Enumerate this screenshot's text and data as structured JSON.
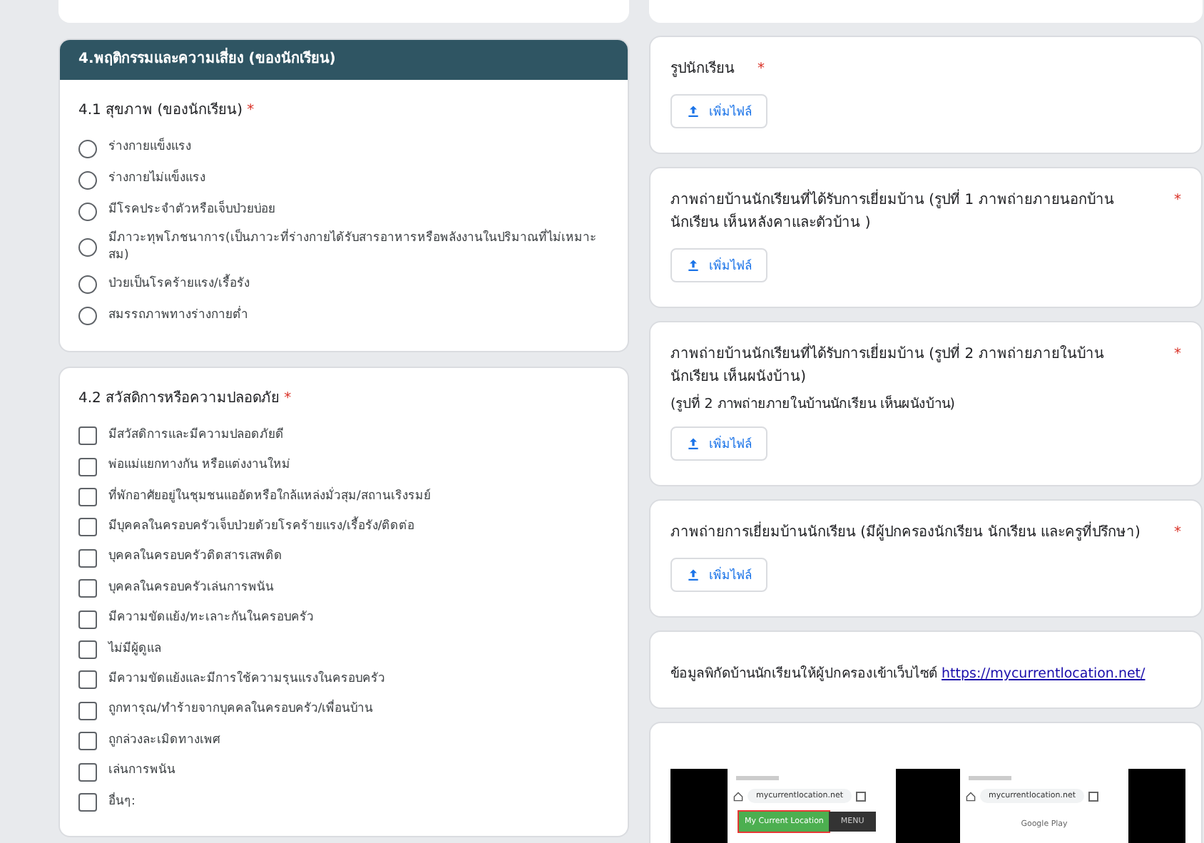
{
  "left_sections": [
    {
      "kind": "radio",
      "header": "4.พฤติกรรมและความเสี่ยง (ของนักเรียน)",
      "question": "4.1 สุขภาพ (ของนักเรียน)",
      "required_mark": "*",
      "options": [
        {
          "label": "ร่างกายแข็งแรง",
          "selected": false
        },
        {
          "label": "ร่างกายไม่แข็งแรง",
          "selected": false
        },
        {
          "label": "มีโรคประจำตัวหรือเจ็บป่วยบ่อย",
          "selected": false
        },
        {
          "label": "มีภาวะทุพโภชนาการ(เป็นภาวะที่ร่างกายได้รับสารอาหารหรือพลังงานในปริมาณที่ไม่เหมาะสม)",
          "selected": false
        },
        {
          "label": "ป่วยเป็นโรคร้ายแรง/เรื้อรัง",
          "selected": false
        },
        {
          "label": "สมรรถภาพทางร่างกายต่ำ",
          "selected": false
        }
      ]
    },
    {
      "kind": "checkbox",
      "question": "4.2  สวัสดิการหรือความปลอดภัย",
      "required_mark": "*",
      "options": [
        {
          "label": "มีสวัสดิการและมีความปลอดภัยดี",
          "checked": false
        },
        {
          "label": "พ่อแม่แยกทางกัน หรือแต่งงานใหม่",
          "checked": false
        },
        {
          "label": "ที่พักอาศัยอยู่ในชุมชนแออัดหรือใกล้แหล่งมั่วสุม/สถานเริงรมย์",
          "checked": false
        },
        {
          "label": "มีบุคคลในครอบครัวเจ็บป่วยด้วยโรคร้ายแรง/เรื้อรัง/ติดต่อ",
          "checked": false
        },
        {
          "label": "บุคคลในครอบครัวติดสารเสพติด",
          "checked": false
        },
        {
          "label": "บุคคลในครอบครัวเล่นการพนัน",
          "checked": false
        },
        {
          "label": "มีความขัดแย้ง/ทะเลาะกันในครอบครัว",
          "checked": false
        },
        {
          "label": "ไม่มีผู้ดูแล",
          "checked": false
        },
        {
          "label": "มีความขัดแย้งและมีการใช้ความรุนแรงในครอบครัว",
          "checked": false
        },
        {
          "label": "ถูกทารุณ/ทำร้ายจากบุคคลในครอบครัว/เพื่อนบ้าน",
          "checked": false
        },
        {
          "label": "ถูกล่วงละเมิดทางเพศ",
          "checked": false
        },
        {
          "label": "เล่นการพนัน",
          "checked": false
        },
        {
          "label": "อื่นๆ:",
          "checked": false
        }
      ]
    }
  ],
  "right_cards": [
    {
      "kind": "upload",
      "title": "รูปนักเรียน",
      "required_mark": "*",
      "button": "เพิ่มไฟล์"
    },
    {
      "kind": "upload",
      "title": "ภาพถ่ายบ้านนักเรียนที่ได้รับการเยี่ยมบ้าน (รูปที่ 1 ภาพถ่ายภายนอกบ้านนักเรียน เห็นหลังคาและตัวบ้าน )",
      "required_mark": "*",
      "button": "เพิ่มไฟล์"
    },
    {
      "kind": "upload",
      "title": "ภาพถ่ายบ้านนักเรียนที่ได้รับการเยี่ยมบ้าน (รูปที่ 2 ภาพถ่ายภายในบ้านนักเรียน เห็นผนังบ้าน)",
      "subtitle": " (รูปที่ 2 ภาพถ่ายภายในบ้านนักเรียน เห็นผนังบ้าน)",
      "required_mark": "*",
      "button": "เพิ่มไฟล์"
    },
    {
      "kind": "upload",
      "title": "ภาพถ่ายการเยี่ยมบ้านนักเรียน (มีผู้ปกครองนักเรียน นักเรียน และครูที่ปรึกษา)",
      "required_mark": "*",
      "button": "เพิ่มไฟล์"
    },
    {
      "kind": "link",
      "text": "ข้อมูลพิกัดบ้านนักเรียนให้ผู้ปกครองเข้าเว็บไซต์",
      "link": "https://mycurrentlocation.net/"
    },
    {
      "kind": "image",
      "phones": [
        {
          "url": "mycurrentlocation.net",
          "button": "My Current Location",
          "menu": "MENU"
        },
        {
          "url": "mycurrentlocation.net",
          "store": "Google Play"
        }
      ]
    }
  ]
}
